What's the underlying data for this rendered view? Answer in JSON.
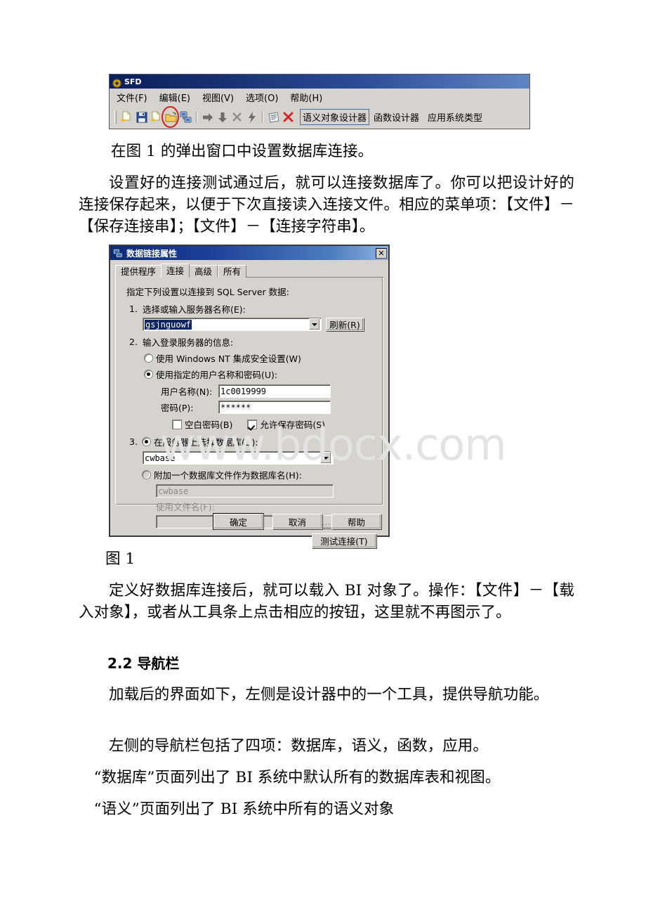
{
  "app_window": {
    "title": "SFD",
    "title_icon": "gear-icon",
    "menu": [
      {
        "label": "文件(F)",
        "accel": "F"
      },
      {
        "label": "编辑(E)",
        "accel": "E"
      },
      {
        "label": "视图(V)",
        "accel": "V"
      },
      {
        "label": "选项(O)",
        "accel": "O"
      },
      {
        "label": "帮助(H)",
        "accel": "H"
      }
    ],
    "toolbar_icons": [
      "load-document-icon",
      "save-icon",
      "export-document-icon",
      "open-folder-icon",
      "database-connection-icon",
      "arrow-right-icon",
      "arrow-down-icon",
      "delete-x-icon",
      "lightning-execute-icon",
      "properties-icon",
      "close-red-x-icon"
    ],
    "toolbar_tabs": [
      {
        "label": "语义对象设计器",
        "active": true
      },
      {
        "label": "函数设计器",
        "active": false
      },
      {
        "label": "应用系统类型",
        "active": false
      }
    ],
    "annotation": "red-ellipse-highlight-on-database-connection-icon"
  },
  "dialog": {
    "title": "数据链接属性",
    "title_icon": "data-link-icon",
    "close_label": "✕",
    "tabs": [
      {
        "label": "提供程序",
        "selected": false
      },
      {
        "label": "连接",
        "selected": true
      },
      {
        "label": "高级",
        "selected": false
      },
      {
        "label": "所有",
        "selected": false
      }
    ],
    "intro": "指定下列设置以连接到 SQL Server 数据:",
    "step1": {
      "number": "1.",
      "label": "选择或输入服务器名称(E):",
      "server_value": "gsjnguowf",
      "refresh_label": "刷新(R)"
    },
    "step2": {
      "number": "2.",
      "label": "输入登录服务器的信息:",
      "radio_windows_auth": "使用 Windows NT 集成安全设置(W)",
      "radio_sql_auth": "使用指定的用户名称和密码(U):",
      "username_label": "用户名称(N):",
      "username_value": "1c0019999",
      "password_label": "密码(P):",
      "password_value": "******",
      "blank_password_label": "空白密码(B)",
      "allow_save_password_label": "允许保存密码(S)"
    },
    "step3": {
      "number": "3.",
      "radio_select_db": "在服务器上选择数据库(D):",
      "database_value": "cwbase",
      "radio_attach_db": "附加一个数据库文件作为数据库名(H):",
      "attach_db_value": "cwbase",
      "filename_label": "使用文件名(F):",
      "filename_value": "",
      "browse_label": "...",
      "test_connection_label": "测试连接(T)"
    },
    "footer": {
      "ok_label": "确定",
      "cancel_label": "取消",
      "help_label": "帮助"
    }
  },
  "document": {
    "p1": "在图 1 的弹出窗口中设置数据库连接。",
    "p2": "设置好的连接测试通过后，就可以连接数据库了。你可以把设计好的连接保存起来，以便于下次直接读入连接文件。相应的菜单项：【文件】－【保存连接串】；【文件】－【连接字符串】。",
    "figure_caption": "图 1",
    "p3": "定义好数据库连接后，就可以载入 BI 对象了。操作：【文件】－【载入对象】，或者从工具条上点击相应的按钮，这里就不再图示了。",
    "section_heading": "2.2 导航栏",
    "p4": "加载后的界面如下，左侧是设计器中的一个工具，提供导航功能。",
    "p5": "左侧的导航栏包括了四项：数据库，语义，函数，应用。",
    "p6": "“数据库”页面列出了 BI 系统中默认所有的数据库表和视图。",
    "p7": "“语义”页面列出了 BI 系统中所有的语义对象"
  },
  "watermark": {
    "text": "www.bdocx.com"
  },
  "colors": {
    "title_bar_dark": "#0a1f5c",
    "dialog_face": "#d6d3ce",
    "accent_blue": "#3a6ea5",
    "selection_blue": "#0a246a",
    "annotation_red": "#e01b1b",
    "watermark_gray": "#e3e3e3"
  }
}
